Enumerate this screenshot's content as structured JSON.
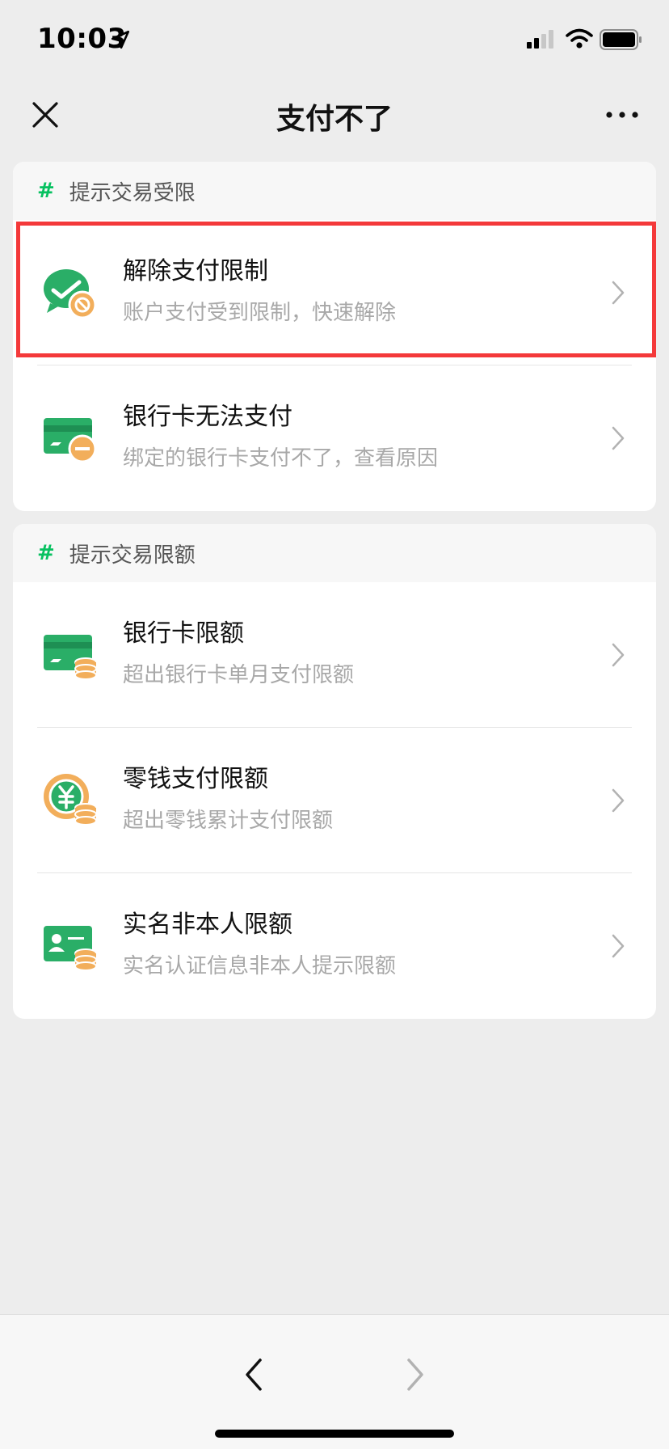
{
  "status_bar": {
    "time": "10:03"
  },
  "nav": {
    "title": "支付不了"
  },
  "sections": [
    {
      "label": "提示交易受限",
      "items": [
        {
          "title": "解除支付限制",
          "subtitle": "账户支付受到限制，快速解除",
          "icon": "wechat-pay-restricted-icon"
        },
        {
          "title": "银行卡无法支付",
          "subtitle": "绑定的银行卡支付不了，查看原因",
          "icon": "bank-card-blocked-icon"
        }
      ]
    },
    {
      "label": "提示交易限额",
      "items": [
        {
          "title": "银行卡限额",
          "subtitle": "超出银行卡单月支付限额",
          "icon": "bank-card-coins-icon"
        },
        {
          "title": "零钱支付限额",
          "subtitle": "超出零钱累计支付限额",
          "icon": "yuan-coin-icon"
        },
        {
          "title": "实名非本人限额",
          "subtitle": "实名认证信息非本人提示限额",
          "icon": "id-card-coins-icon"
        }
      ]
    }
  ],
  "colors": {
    "accent": "#07c160",
    "coin": "#f2ae5b",
    "highlight": "#f4393a"
  }
}
